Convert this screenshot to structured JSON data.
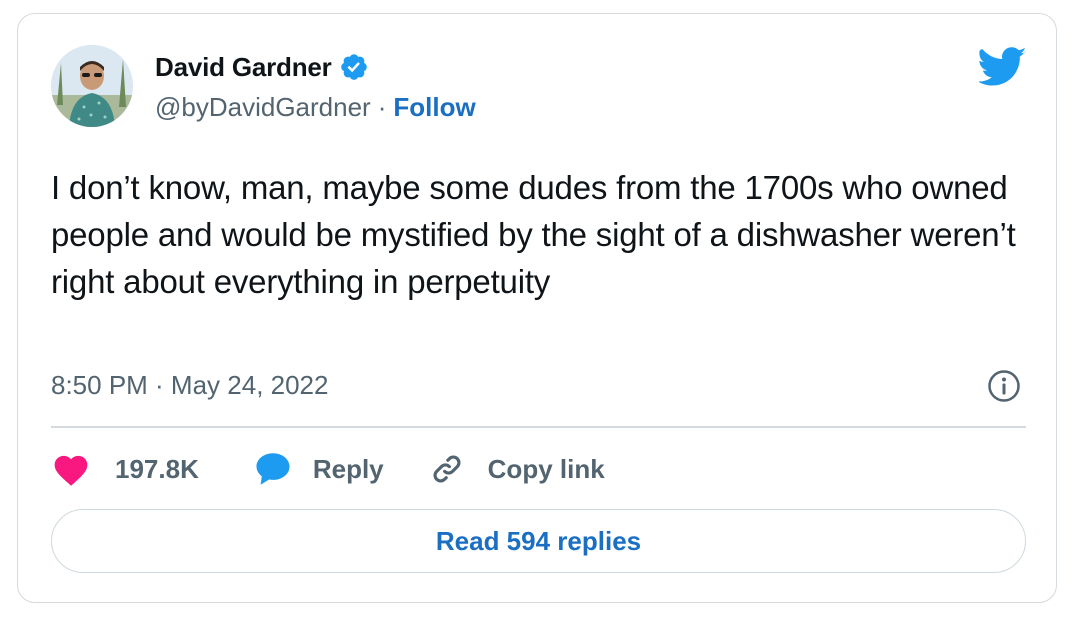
{
  "author": {
    "display_name": "David Gardner",
    "handle": "@byDavidGardner",
    "separator": "·",
    "follow_label": "Follow",
    "verified_icon": "verified-badge-icon"
  },
  "brand": {
    "logo_icon": "twitter-bird-icon",
    "accent_color": "#1d9bf0",
    "link_color": "#1b6fc3"
  },
  "tweet": {
    "text": "I don’t know, man, maybe some dudes from the 1700s who owned people and would be mystified by the sight of a dishwasher weren’t right about everything in perpetuity",
    "timestamp": "8:50 PM · May 24, 2022",
    "info_icon": "info-icon"
  },
  "actions": {
    "like_count": "197.8K",
    "like_icon": "heart-icon",
    "like_color": "#f91880",
    "reply_label": "Reply",
    "reply_icon": "reply-bubble-icon",
    "copy_link_label": "Copy link",
    "copy_link_icon": "link-icon"
  },
  "footer": {
    "read_replies_label": "Read 594 replies"
  }
}
